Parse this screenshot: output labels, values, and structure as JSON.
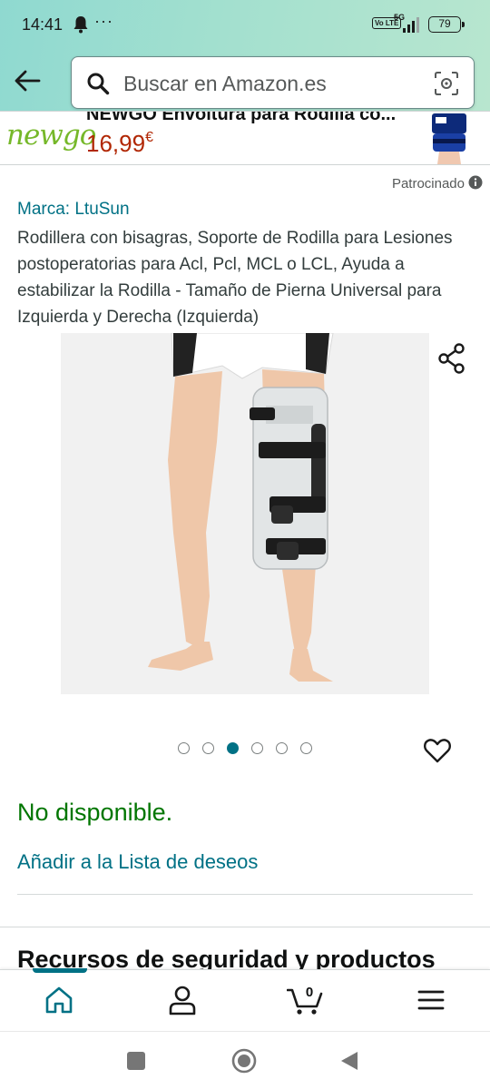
{
  "status_bar": {
    "time": "14:41",
    "dots": "···",
    "volte": "Vo LTE",
    "network": "5G",
    "battery": "79"
  },
  "search": {
    "placeholder": "Buscar en Amazon.es"
  },
  "sponsored_banner": {
    "brand_logo": "newgo",
    "title": "NEWGO Envoltura para Rodilla co...",
    "price": "16,99",
    "currency": "€"
  },
  "sponsored_label": "Patrocinado",
  "product": {
    "brand": "Marca: LtuSun",
    "title": "Rodillera con bisagras, Soporte de Rodilla para Lesiones postoperatorias para Acl, Pcl, MCL o LCL, Ayuda a estabilizar la Rodilla - Tamaño de Pierna Universal para Izquierda y Derecha (Izquierda)",
    "image_count": 6,
    "active_image": 3,
    "availability": "No disponible.",
    "wishlist_link": "Añadir a la Lista de deseos"
  },
  "section_heading": "Recursos de seguridad y productos",
  "bottom_nav": {
    "cart_count": "0",
    "active_tab": "home",
    "items": [
      "home-icon",
      "account-icon",
      "cart-icon",
      "menu-icon"
    ]
  },
  "colors": {
    "link": "#007185",
    "price": "#b12704",
    "available": "#007600",
    "header_gradient_start": "#8fd9d0",
    "header_gradient_end": "#b8e6cf"
  }
}
